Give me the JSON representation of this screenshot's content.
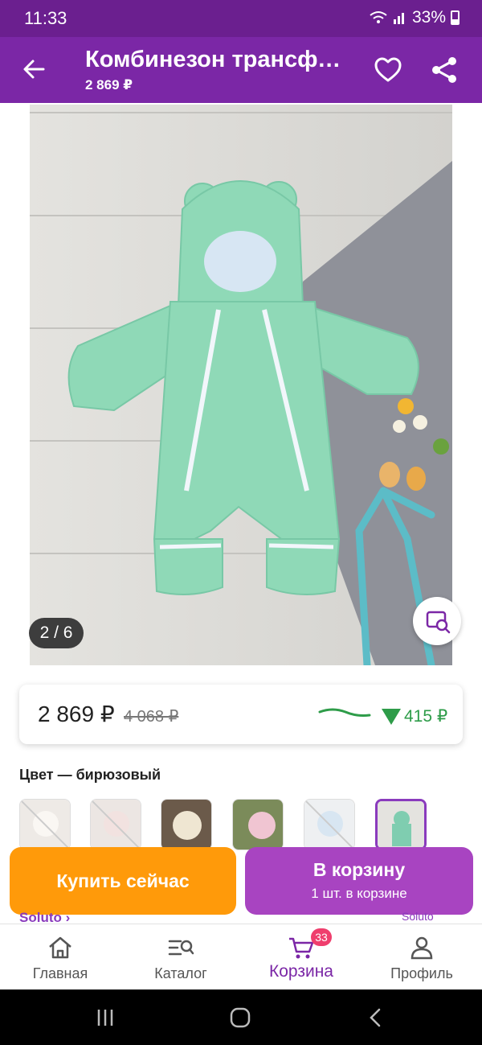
{
  "status_bar": {
    "time": "11:33",
    "battery": "33%"
  },
  "app_bar": {
    "title": "Комбинезон трансформер",
    "price": "2 869 ₽"
  },
  "gallery": {
    "counter": "2 / 6"
  },
  "price_card": {
    "current": "2 869 ₽",
    "old": "4 068 ₽",
    "drop": "415 ₽",
    "drop_color": "#2e9c49"
  },
  "color": {
    "label": "Цвет — бирюзовый"
  },
  "actions": {
    "buy_now": "Купить сейчас",
    "add_to_cart": "В корзину",
    "cart_note": "1 шт. в корзине"
  },
  "peek": {
    "brand": "Soluto ›",
    "brand_logo": "Soluto"
  },
  "nav": {
    "items": [
      {
        "label": "Главная",
        "icon": "home-icon"
      },
      {
        "label": "Каталог",
        "icon": "catalog-search-icon"
      },
      {
        "label": "Корзина",
        "icon": "cart-icon",
        "badge": "33"
      },
      {
        "label": "Профиль",
        "icon": "profile-icon"
      }
    ]
  },
  "colors": {
    "brand": "#7b27a6",
    "buy": "#ff9a0a",
    "cart": "#a844c1"
  }
}
